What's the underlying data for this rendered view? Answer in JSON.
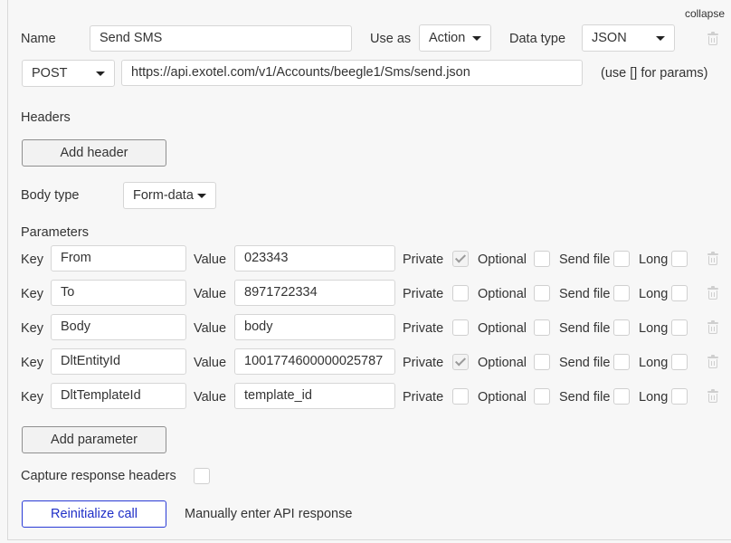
{
  "collapse_label": "collapse",
  "call": {
    "name_label": "Name",
    "name_value": "Send SMS",
    "use_as_label": "Use as",
    "use_as_value": "Action",
    "data_type_label": "Data type",
    "data_type_value": "JSON",
    "method_value": "POST",
    "url_value": "https://api.exotel.com/v1/Accounts/beegle1/Sms/send.json",
    "params_hint": "(use [] for params)"
  },
  "headers": {
    "title": "Headers",
    "add_button": "Add header"
  },
  "body_type": {
    "label": "Body type",
    "value": "Form-data"
  },
  "parameters": {
    "title": "Parameters",
    "key_label": "Key",
    "value_label": "Value",
    "private_label": "Private",
    "optional_label": "Optional",
    "send_file_label": "Send file",
    "long_label": "Long",
    "rows": [
      {
        "key": "From",
        "value": "023343",
        "private": true,
        "optional": false,
        "send_file": false,
        "long": false
      },
      {
        "key": "To",
        "value": "8971722334",
        "private": false,
        "optional": false,
        "send_file": false,
        "long": false
      },
      {
        "key": "Body",
        "value": "body",
        "private": false,
        "optional": false,
        "send_file": false,
        "long": false
      },
      {
        "key": "DltEntityId",
        "value": "1001774600000025787",
        "private": true,
        "optional": false,
        "send_file": false,
        "long": false
      },
      {
        "key": "DltTemplateId",
        "value": "template_id",
        "private": false,
        "optional": false,
        "send_file": false,
        "long": false
      }
    ],
    "add_button": "Add parameter"
  },
  "capture_headers_label": "Capture response headers",
  "capture_headers_checked": false,
  "reinitialize_button": "Reinitialize call",
  "manual_response_label": "Manually enter API response",
  "colors": {
    "primary_border": "#2a3bd6",
    "primary_text": "#1f2fc7",
    "background": "#f7f7f7"
  }
}
